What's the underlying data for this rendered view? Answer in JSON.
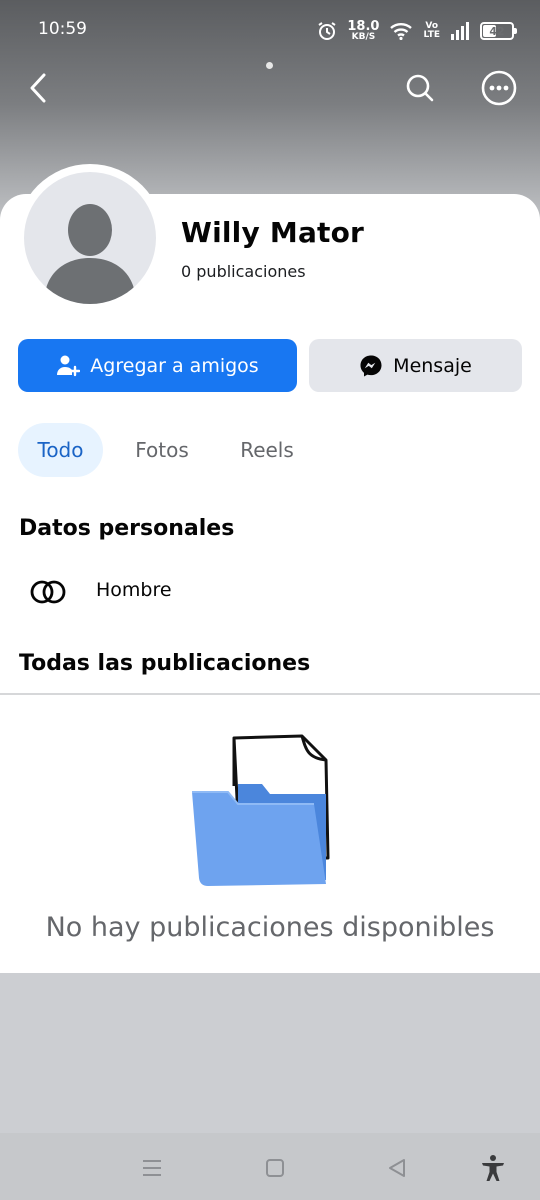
{
  "status_bar": {
    "time": "10:59",
    "net_speed_value": "18.0",
    "net_speed_unit": "KB/S",
    "volte_top": "Vo",
    "volte_bottom": "LTE",
    "battery": "42",
    "icons": [
      "alarm-icon",
      "wifi-icon",
      "signal-icon",
      "battery-icon"
    ]
  },
  "top_nav": {
    "icons": [
      "back-arrow-icon",
      "search-icon",
      "more-options-icon"
    ]
  },
  "profile": {
    "name": "Willy Mator",
    "posts_count": "0 publicaciones"
  },
  "actions": {
    "add_friend_label": "Agregar a amigos",
    "message_label": "Mensaje",
    "add_friend_color": "#1877f2"
  },
  "tabs": [
    {
      "label": "Todo",
      "active": true
    },
    {
      "label": "Fotos",
      "active": false
    },
    {
      "label": "Reels",
      "active": false
    }
  ],
  "personal_data": {
    "title": "Datos personales",
    "gender": "Hombre"
  },
  "posts_section": {
    "title": "Todas las publicaciones",
    "empty_message": "No hay publicaciones disponibles"
  },
  "system_nav": {
    "icons": [
      "menu-icon",
      "home-icon",
      "back-icon",
      "accessibility-icon"
    ]
  }
}
